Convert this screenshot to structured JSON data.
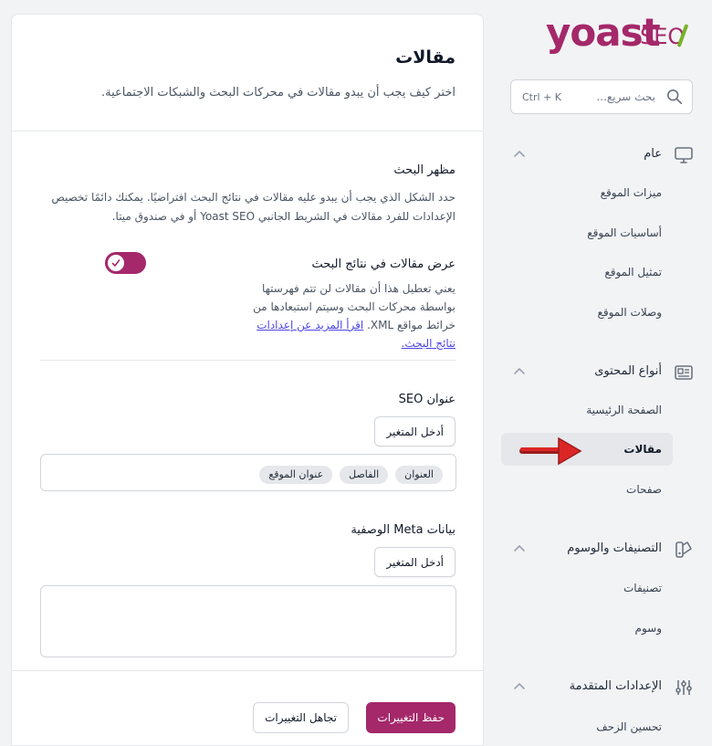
{
  "brand": {
    "name": "yoast",
    "suffix": "SEO",
    "color": "#a4286a",
    "accent": "#77b227"
  },
  "search": {
    "placeholder": "بحث سريع...",
    "shortcut": "Ctrl + K",
    "icon": "search-icon"
  },
  "sidebar": {
    "groups": [
      {
        "title": "عام",
        "icon": "monitor-icon",
        "items": [
          "ميزات الموقع",
          "أساسيات الموقع",
          "تمثيل الموقع",
          "وصلات الموقع"
        ]
      },
      {
        "title": "أنواع المحتوى",
        "icon": "newspaper-icon",
        "items": [
          "الصفحة الرئيسية",
          "مقالات",
          "صفحات"
        ],
        "active": "مقالات"
      },
      {
        "title": "التصنيفات والوسوم",
        "icon": "tag-swatch-icon",
        "items": [
          "تصنيفات",
          "وسوم"
        ]
      },
      {
        "title": "الإعدادات المتقدمة",
        "icon": "sliders-icon",
        "items": [
          "تحسين الزحف"
        ]
      }
    ]
  },
  "main": {
    "title": "مقالات",
    "description": "اختر كيف يجب أن يبدو مقالات في محركات البحث والشبكات الاجتماعية.",
    "search_appearance": {
      "title": "مظهر البحث",
      "description": "حدد الشكل الذي يجب أن يبدو عليه مقالات في نتائج البحث افتراضيًا. يمكنك دائمًا تخصيص الإعدادات للفرد مقالات في الشريط الجانبي Yoast SEO أو في صندوق ميتا."
    },
    "toggle": {
      "label": "عرض مقالات في نتائج البحث",
      "enabled": true,
      "description": "يعني تعطيل هذا أن مقالات لن تتم فهرستها بواسطة محركات البحث وسيتم استبعادها من خرائط مواقع XML.",
      "link": "اقرأ المزيد عن إعدادات نتائج البحث."
    },
    "seo_title": {
      "label": "عنوان SEO",
      "insert_variable": "أدخل المتغير",
      "chips": [
        "العنوان",
        "الفاصل",
        "عنوان الموقع"
      ]
    },
    "meta_description": {
      "label": "بيانات Meta الوصفية",
      "insert_variable": "أدخل المتغير",
      "value": ""
    },
    "footer": {
      "save": "حفظ التغييرات",
      "discard": "تجاهل التغييرات"
    }
  }
}
